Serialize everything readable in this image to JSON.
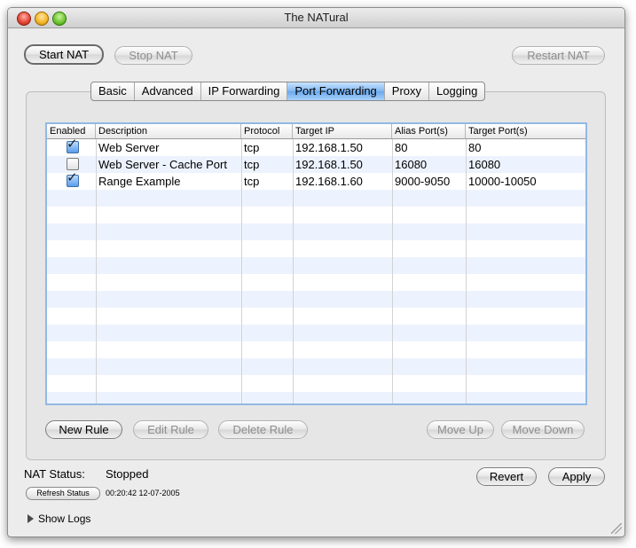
{
  "window": {
    "title": "The NATural"
  },
  "toolbar": {
    "start_nat": "Start NAT",
    "stop_nat": "Stop NAT",
    "restart_nat": "Restart NAT"
  },
  "tabs": [
    {
      "label": "Basic",
      "selected": false
    },
    {
      "label": "Advanced",
      "selected": false
    },
    {
      "label": "IP Forwarding",
      "selected": false
    },
    {
      "label": "Port Forwarding",
      "selected": true
    },
    {
      "label": "Proxy",
      "selected": false
    },
    {
      "label": "Logging",
      "selected": false
    }
  ],
  "table": {
    "columns": [
      "Enabled",
      "Description",
      "Protocol",
      "Target IP",
      "Alias Port(s)",
      "Target Port(s)"
    ],
    "rows": [
      {
        "enabled": true,
        "description": "Web Server",
        "protocol": "tcp",
        "target_ip": "192.168.1.50",
        "alias_ports": "80",
        "target_ports": "80"
      },
      {
        "enabled": false,
        "description": "Web Server - Cache Port",
        "protocol": "tcp",
        "target_ip": "192.168.1.50",
        "alias_ports": "16080",
        "target_ports": "16080"
      },
      {
        "enabled": true,
        "description": "Range Example",
        "protocol": "tcp",
        "target_ip": "192.168.1.60",
        "alias_ports": "9000-9050",
        "target_ports": "10000-10050"
      }
    ]
  },
  "rule_buttons": {
    "new_rule": "New Rule",
    "edit_rule": "Edit Rule",
    "delete_rule": "Delete Rule",
    "move_up": "Move Up",
    "move_down": "Move Down"
  },
  "status": {
    "label": "NAT Status:",
    "value": "Stopped",
    "refresh_button": "Refresh Status",
    "timestamp": "00:20:42 12-07-2005"
  },
  "footer": {
    "revert": "Revert",
    "apply": "Apply",
    "show_logs": "Show Logs"
  },
  "icons": {
    "checkbox_checked": "checkmark-icon",
    "disclosure": "disclosure-triangle-icon",
    "resize": "resize-grip-icon"
  }
}
